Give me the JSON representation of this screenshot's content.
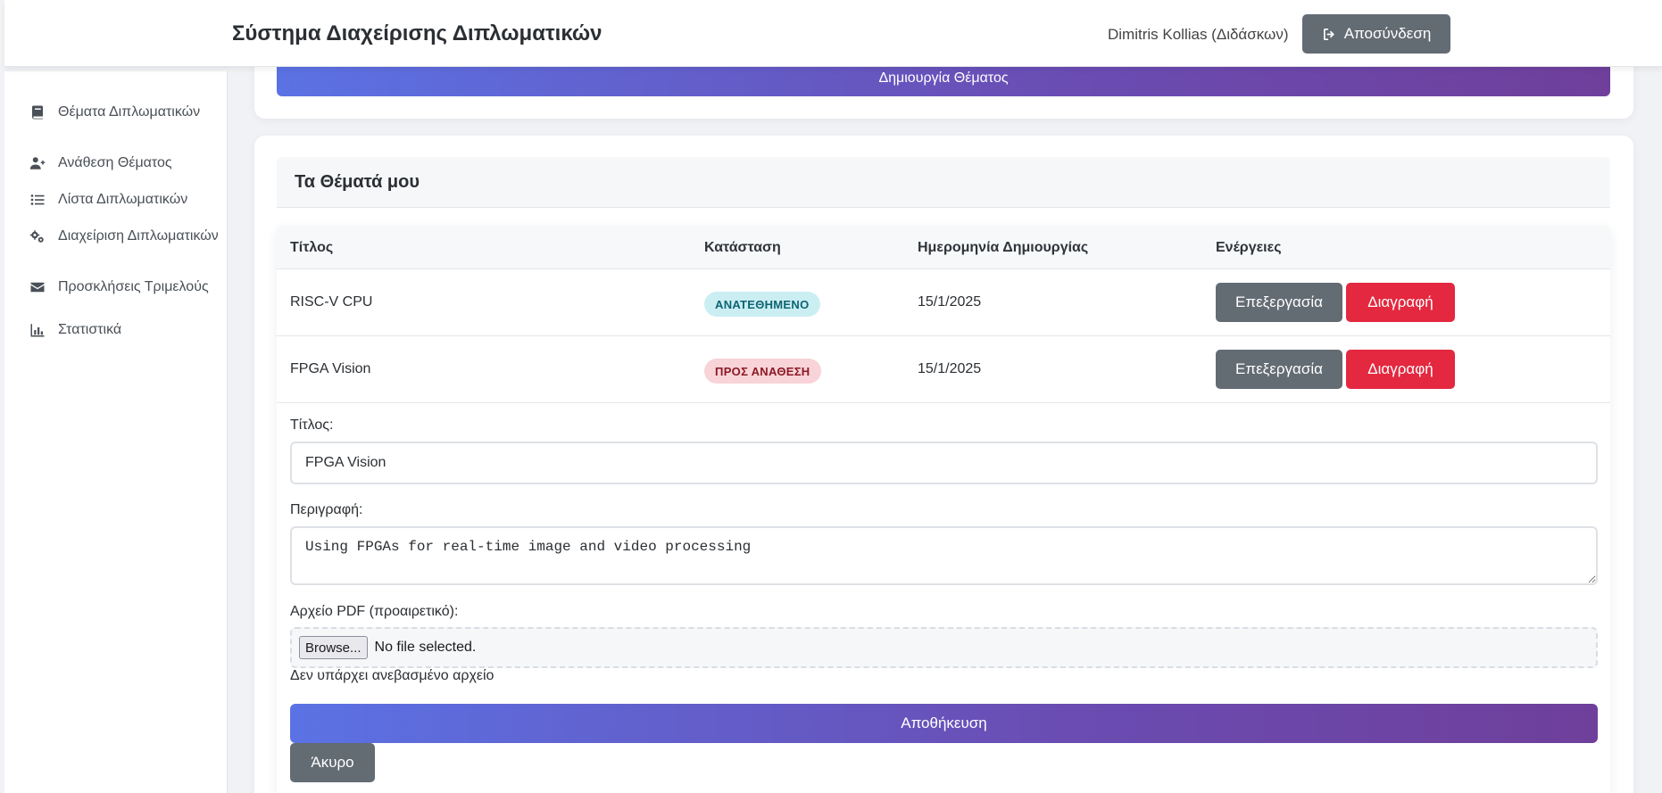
{
  "header": {
    "app_title": "Σύστημα Διαχείρισης Διπλωματικών",
    "user_name": "Dimitris Kollias (Διδάσκων)",
    "logout_label": "Αποσύνδεση",
    "logout_icon": "sign-out-icon"
  },
  "sidebar": {
    "items": [
      {
        "label": "Θέματα Διπλωματικών",
        "icon": "book-icon"
      },
      {
        "label": "Ανάθεση Θέματος",
        "icon": "user-plus-icon"
      },
      {
        "label": "Λίστα Διπλωματικών",
        "icon": "list-icon"
      },
      {
        "label": "Διαχείριση Διπλωματικών",
        "icon": "gears-icon"
      },
      {
        "label": "Προσκλήσεις Τριμελούς",
        "icon": "envelope-icon"
      },
      {
        "label": "Στατιστικά",
        "icon": "chart-icon"
      }
    ]
  },
  "create_button_label": "Δημιουργία Θέματος",
  "topics": {
    "title": "Τα Θέματά μου",
    "columns": [
      "Τίτλος",
      "Κατάσταση",
      "Ημερομηνία Δημιουργίας",
      "Ενέργειες"
    ],
    "rows": [
      {
        "title": "RISC-V CPU",
        "status": "ΑΝΑΤΕΘΗΜΕΝΟ",
        "date": "15/1/2025",
        "edit": "Επεξεργασία",
        "delete": "Διαγραφή"
      },
      {
        "title": "FPGA Vision",
        "status": "ΠΡΟΣ ΑΝΑΘΕΣΗ",
        "date": "15/1/2025",
        "edit": "Επεξεργασία",
        "delete": "Διαγραφή"
      }
    ]
  },
  "edit_form": {
    "title_label": "Τίτλος:",
    "title_value": "FPGA Vision",
    "description_label": "Περιγραφή:",
    "description_value": "Using FPGAs for real-time image and video processing",
    "pdf_label": "Αρχείο PDF (προαιρετικό):",
    "browse_label": "Browse...",
    "file_status": "No file selected.",
    "no_file_text": "Δεν υπάρχει ανεβασμένο αρχείο",
    "save_label": "Αποθήκευση",
    "cancel_label": "Άκυρο"
  },
  "colors": {
    "accent_gradient_start": "#5b72e4",
    "accent_gradient_end": "#6f3f9b",
    "secondary_button": "#636b73",
    "danger_button": "#e3283f",
    "badge_assigned_bg": "#cbeef3",
    "badge_pending_bg": "#f8d3d7"
  }
}
